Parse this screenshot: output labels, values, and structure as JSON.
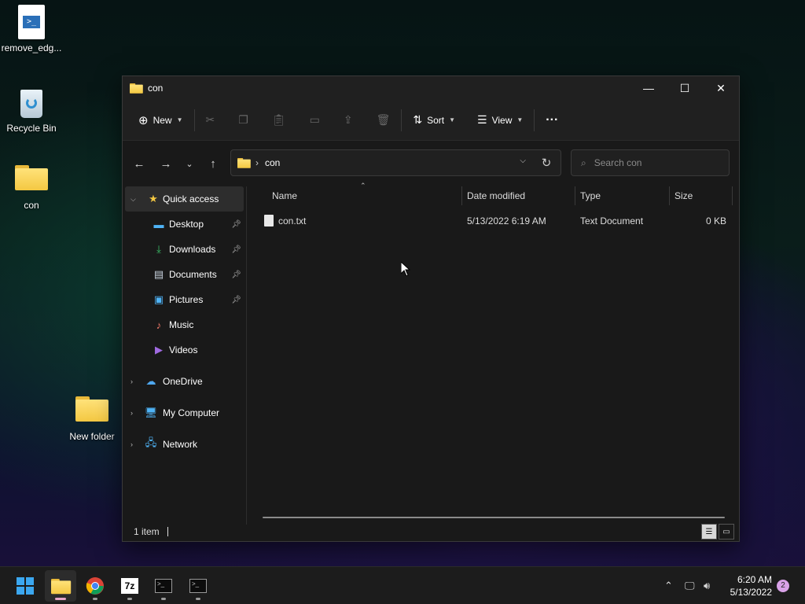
{
  "desktop": {
    "icons": [
      {
        "label": "remove_edg..."
      },
      {
        "label": "Recycle Bin"
      },
      {
        "label": "con"
      },
      {
        "label": "New folder"
      }
    ]
  },
  "window": {
    "title": "con",
    "controls": {
      "minimize": "—",
      "maximize": "☐",
      "close": "✕"
    }
  },
  "commandbar": {
    "new_label": "New",
    "sort_label": "Sort",
    "view_label": "View",
    "more_label": "···"
  },
  "address": {
    "path": "con",
    "search_placeholder": "Search con"
  },
  "navpane": {
    "quick_access": "Quick access",
    "items": [
      {
        "label": "Desktop",
        "pinned": true
      },
      {
        "label": "Downloads",
        "pinned": true
      },
      {
        "label": "Documents",
        "pinned": true
      },
      {
        "label": "Pictures",
        "pinned": true
      },
      {
        "label": "Music",
        "pinned": false
      },
      {
        "label": "Videos",
        "pinned": false
      }
    ],
    "roots": [
      {
        "label": "OneDrive"
      },
      {
        "label": "My Computer"
      },
      {
        "label": "Network"
      }
    ]
  },
  "list": {
    "columns": [
      "Name",
      "Date modified",
      "Type",
      "Size"
    ],
    "rows": [
      {
        "name": "con.txt",
        "date": "5/13/2022 6:19 AM",
        "type": "Text Document",
        "size": "0 KB"
      }
    ]
  },
  "status": {
    "count": "1 item"
  },
  "taskbar": {
    "time": "6:20 AM",
    "date": "5/13/2022",
    "notification_count": "2",
    "sevenzip_label": "7z"
  },
  "colors": {
    "accent": "#0078d4",
    "folder": "#f4c842",
    "window_bg": "#191919"
  }
}
